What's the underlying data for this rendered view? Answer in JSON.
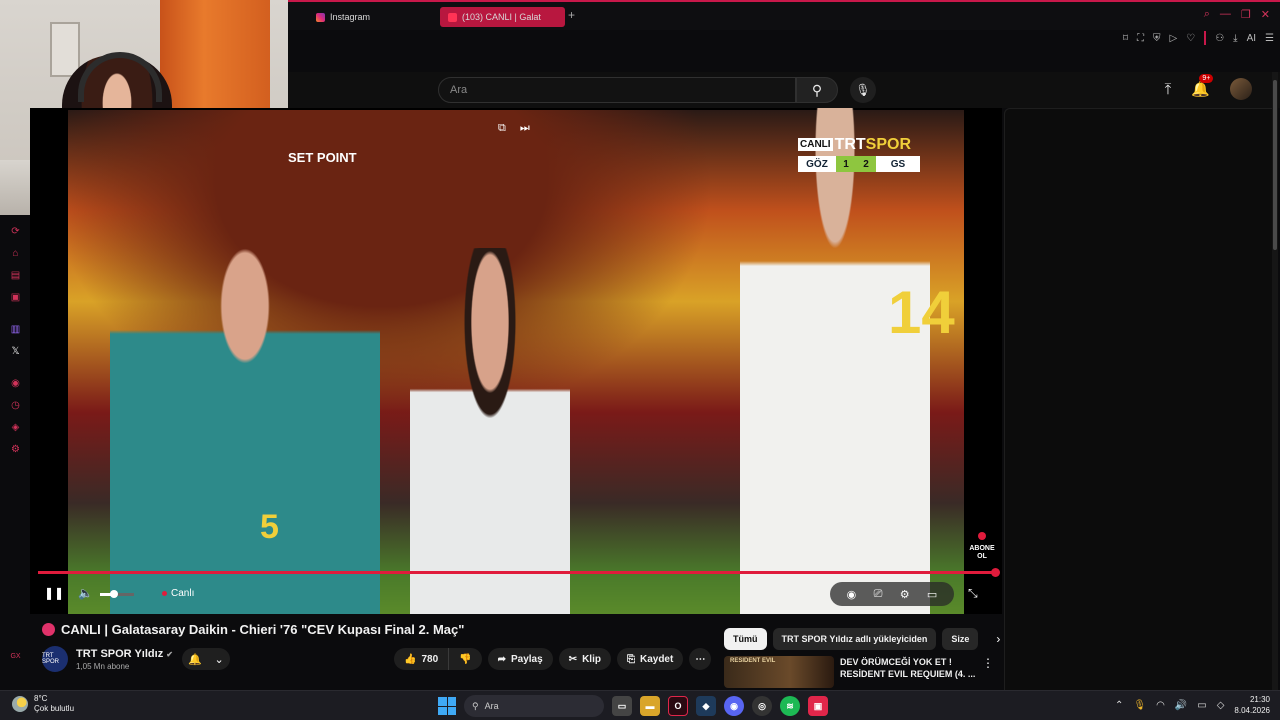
{
  "browser": {
    "tabs": [
      {
        "label": "Instagram"
      },
      {
        "label": "(103)  CANLI | Galat"
      }
    ],
    "new_tab": "+",
    "ai_label": "AI"
  },
  "youtube": {
    "search": {
      "placeholder": "Ara"
    },
    "notification_badge": "9+"
  },
  "video": {
    "overlay_text": "SET POINT",
    "scoreboard": {
      "live_tag": "CANLI",
      "brand_left": "TRT",
      "brand_right": "SPOR",
      "team1": "GÖZ",
      "score1": "1",
      "score2": "2",
      "team2": "GS"
    },
    "jersey_number_right": "14",
    "jersey_number_left": "5",
    "subscribe_label": "ABONE OL",
    "live_label": "Canlı",
    "progress_fraction": 1.0
  },
  "meta": {
    "title": "CANLI | Galatasaray Daikin - Chieri '76 \"CEV Kupası Final 2. Maç\"",
    "channel_name": "TRT SPOR Yıldız",
    "channel_avatar_text": "TRT SPOR",
    "subscribers": "1,05 Mn abone",
    "likes": "780",
    "share_label": "Paylaş",
    "clip_label": "Klip",
    "save_label": "Kaydet"
  },
  "chips": [
    {
      "label": "Tümü"
    },
    {
      "label": "TRT SPOR Yıldız adlı yükleyiciden"
    },
    {
      "label": "Size"
    }
  ],
  "recommendation": {
    "thumb_text": "RESIDENT EVIL",
    "title": "DEV ÖRÜMCEĞİ YOK ET ! RESİDENT EVIL REQUIEM (4. ..."
  },
  "taskbar": {
    "temperature": "8°C",
    "weather": "Çok bulutlu",
    "search": "Ara",
    "time": "21:30",
    "date": "8.04.2026"
  }
}
